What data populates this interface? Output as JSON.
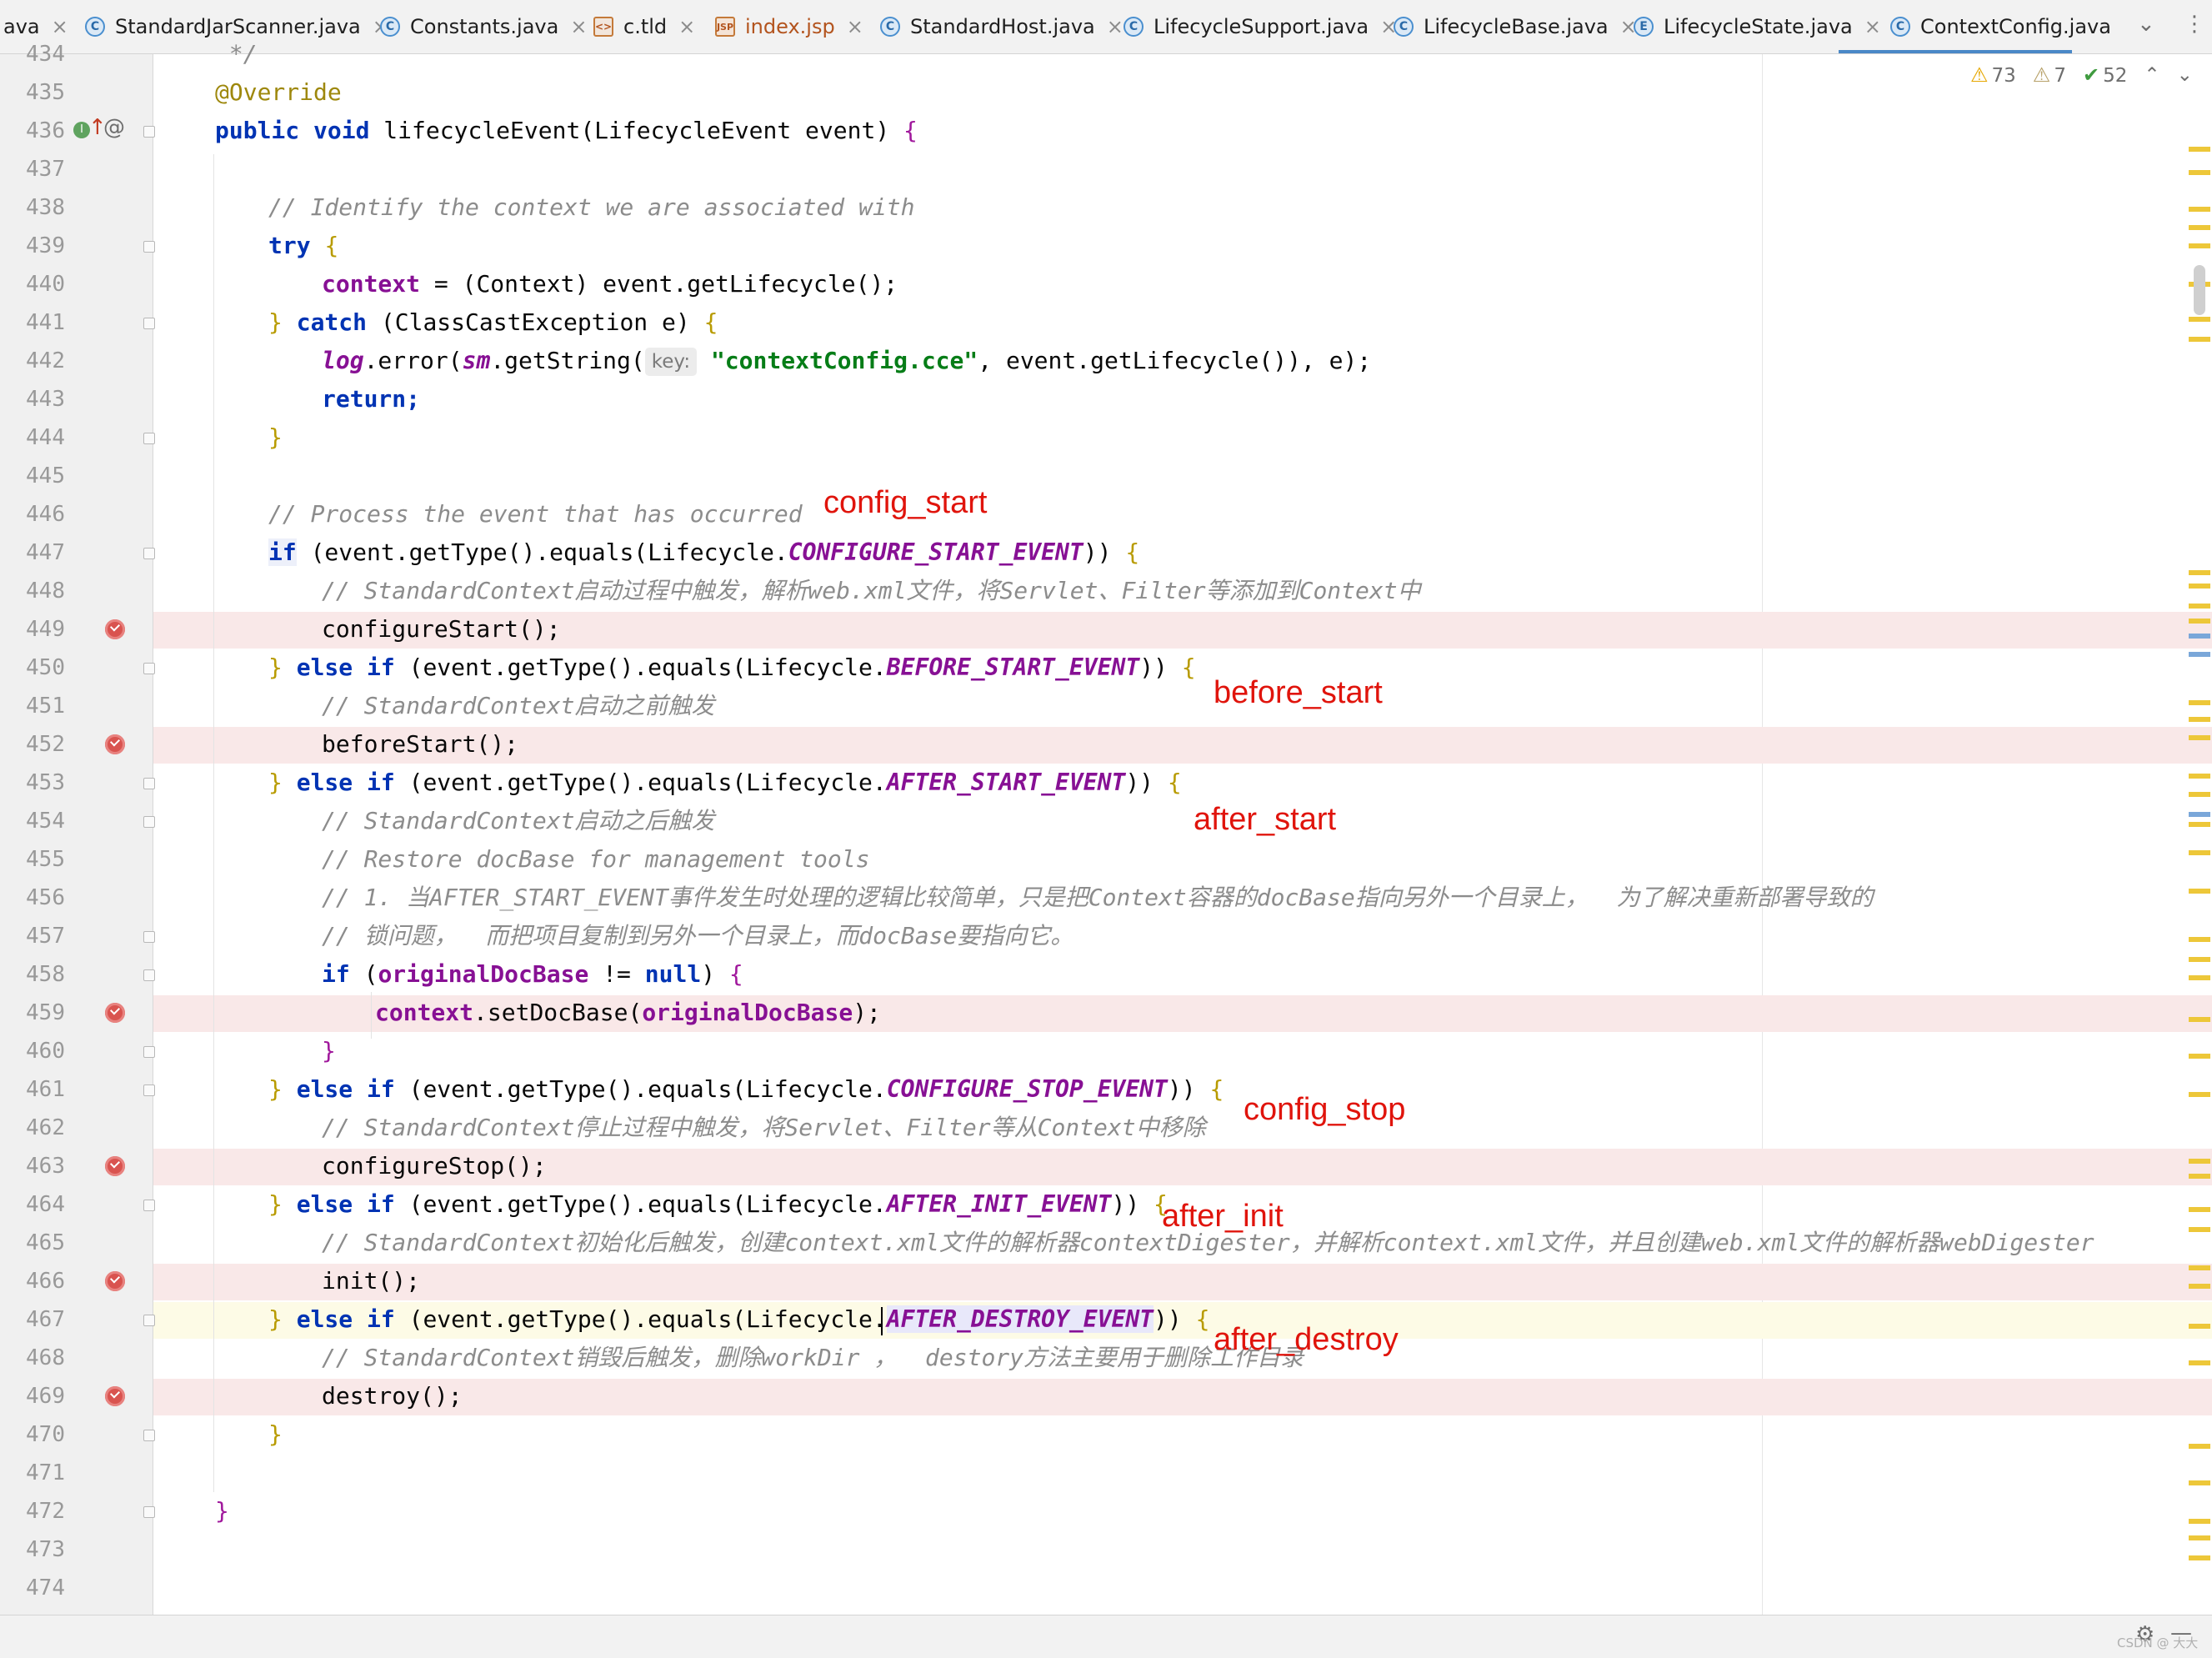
{
  "tabs": [
    {
      "label": "ava",
      "icon": "none"
    },
    {
      "label": "StandardJarScanner.java",
      "icon": "C"
    },
    {
      "label": "Constants.java",
      "icon": "C"
    },
    {
      "label": "c.tld",
      "icon": "tld"
    },
    {
      "label": "index.jsp",
      "icon": "jsp"
    },
    {
      "label": "StandardHost.java",
      "icon": "C"
    },
    {
      "label": "LifecycleSupport.java",
      "icon": "C"
    },
    {
      "label": "LifecycleBase.java",
      "icon": "C"
    },
    {
      "label": "LifecycleState.java",
      "icon": "E"
    },
    {
      "label": "ContextConfig.java",
      "icon": "C",
      "active": true
    }
  ],
  "inspection": {
    "errors": "73",
    "warnings": "7",
    "ok": "52"
  },
  "lines": {
    "l434": "434",
    "l435": "435",
    "l436": "436",
    "l437": "437",
    "l438": "438",
    "l439": "439",
    "l440": "440",
    "l441": "441",
    "l442": "442",
    "l443": "443",
    "l444": "444",
    "l445": "445",
    "l446": "446",
    "l447": "447",
    "l448": "448",
    "l449": "449",
    "l450": "450",
    "l451": "451",
    "l452": "452",
    "l453": "453",
    "l454": "454",
    "l455": "455",
    "l456": "456",
    "l457": "457",
    "l458": "458",
    "l459": "459",
    "l460": "460",
    "l461": "461",
    "l462": "462",
    "l463": "463",
    "l464": "464",
    "l465": "465",
    "l466": "466",
    "l467": "467",
    "l468": "468",
    "l469": "469",
    "l470": "470",
    "l471": "471",
    "l472": "472",
    "l473": "473",
    "l474": "474"
  },
  "code": {
    "t434": " */",
    "override": "@Override",
    "method_sig_public": "public",
    "method_sig_void": "void",
    "method_sig_rest": " lifecycleEvent(LifecycleEvent event) ",
    "c438": "// Identify the context we are associated with",
    "try": "try",
    "l440_field": "context",
    "l440_rest": " = (Context) event.getLifecycle();",
    "catch": "catch",
    "l441_rest": " (ClassCastException e) ",
    "l442_log": "log",
    "l442_a": ".error(",
    "l442_sm": "sm",
    "l442_b": ".getString(",
    "l442_hint": "key:",
    "l442_str": "\"contextConfig.cce\"",
    "l442_c": ", event.getLifecycle()), e);",
    "return": "return;",
    "c446": "// Process the event that has occurred",
    "if": "if",
    "elseif": "else if",
    "l_equals_pre": " (event.getType().equals(Lifecycle.",
    "c_configure_start": "CONFIGURE_START_EVENT",
    "c_before_start": "BEFORE_START_EVENT",
    "c_after_start": "AFTER_START_EVENT",
    "c_configure_stop": "CONFIGURE_STOP_EVENT",
    "c_after_init": "AFTER_INIT_EVENT",
    "c_after_destroy": "AFTER_DESTROY_EVENT",
    "c448": "// StandardContext启动过程中触发，解析web.xml文件，将Servlet、Filter等添加到Context中",
    "configureStart": "configureStart();",
    "c451": "// StandardContext启动之前触发",
    "beforeStart": "beforeStart();",
    "c454": "// StandardContext启动之后触发",
    "c455": "// Restore docBase for management tools",
    "c456": "// 1. 当AFTER_START_EVENT事件发生时处理的逻辑比较简单，只是把Context容器的docBase指向另外一个目录上，  为了解决重新部署导致的",
    "c457": "// 锁问题，  而把项目复制到另外一个目录上，而docBase要指向它。",
    "l458_field": "originalDocBase",
    "l458_ne": " != ",
    "null": "null",
    "l459_field": "context",
    "l459_mid": ".setDocBase(",
    "l459_arg": "originalDocBase",
    "l459_end": ");",
    "c462": "// StandardContext停止过程中触发，将Servlet、Filter等从Context中移除",
    "configureStop": "configureStop();",
    "c465": "// StandardContext初始化后触发，创建context.xml文件的解析器contextDigester，并解析context.xml文件，并且创建web.xml文件的解析器webDigester",
    "init": "init();",
    "c468": "// StandardContext销毁后触发，删除workDir ，  destory方法主要用于删除工作目录",
    "destroy": "destroy();"
  },
  "annotations": {
    "config_start": "config_start",
    "before_start": "before_start",
    "after_start": "after_start",
    "config_stop": "config_stop",
    "after_init": "after_init",
    "after_destroy": "after_destroy"
  },
  "watermark": "CSDN @ 大大",
  "colors": {
    "annotation": "#e0140c",
    "breakpoint": "#d9534f",
    "active_tab": "#4a88c7"
  }
}
